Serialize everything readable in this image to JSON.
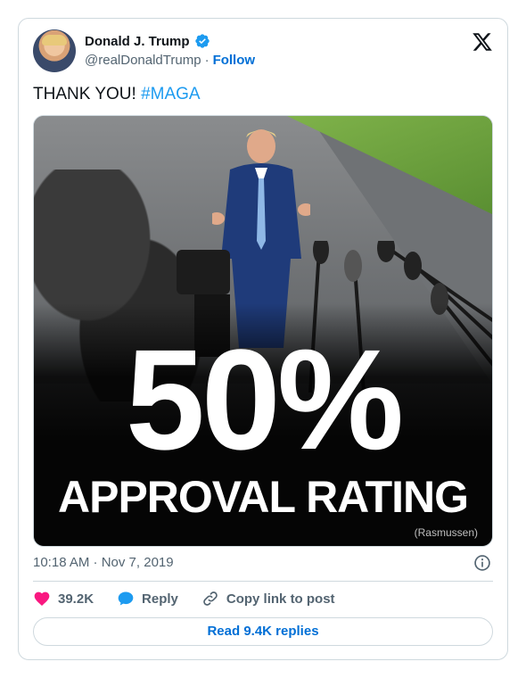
{
  "tweet": {
    "author": {
      "display_name": "Donald J. Trump",
      "handle": "@realDonaldTrump",
      "verified": true,
      "follow_label": "Follow"
    },
    "text_main": "THANK YOU! ",
    "hashtag": "#MAGA",
    "image": {
      "headline_pct": "50%",
      "headline_label": "APPROVAL RATING",
      "source": "(Rasmussen)"
    },
    "timestamp": "10:18 AM · Nov 7, 2019",
    "actions": {
      "likes": "39.2K",
      "reply_label": "Reply",
      "copy_link_label": "Copy link to post"
    },
    "read_replies_label": "Read 9.4K replies"
  },
  "icons": {
    "brand": "x-logo-icon",
    "verified": "verified-badge-icon",
    "info": "info-icon",
    "like": "heart-icon",
    "reply": "speech-bubble-icon",
    "copy": "link-icon"
  },
  "colors": {
    "link": "#006fd6",
    "hashtag": "#1d9bf0",
    "heart": "#f91880",
    "reply": "#1d9bf0",
    "muted": "#536471",
    "border": "#cfd9de"
  }
}
